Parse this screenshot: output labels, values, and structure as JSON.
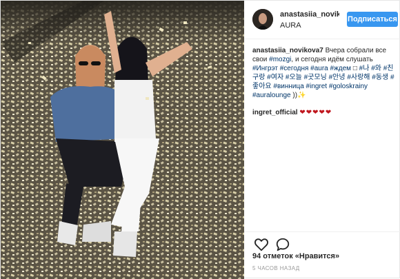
{
  "photo": {
    "description_icon": "photo-of-two-women-in-confetti"
  },
  "header": {
    "username": "anastasiia_novikova7",
    "username_display": "anastasiia_novikov",
    "location": "AURA",
    "follow_label": "Подписаться"
  },
  "comments": {
    "caption_user": "anastasiia_novikova7",
    "caption_text_1": "Вчера собрали все свои ",
    "mention_mozgi": "#mozgi",
    "caption_text_2": ", и сегодня идём слушать ",
    "hashtags_1": "#Ингрэт #сегодня #aura #ждем ",
    "emoji_box": "□",
    "hashtags_2": " #나 #와 #친구랑 #여자 #오늘 #굿모닝 #안녕 #사랑해 #동생 #좋아요 #винница #ingret #goloskrainy #auralounge",
    "caption_tail": " ))",
    "sparkle": "✨",
    "reply_user": "ingret_official",
    "reply_hearts": "❤❤❤❤❤"
  },
  "actions": {
    "like_icon": "heart-icon",
    "comment_icon": "comment-icon",
    "likes_text": "94 отметок «Нравится»",
    "time_text": "5 ЧАСОВ НАЗАД"
  },
  "colors": {
    "follow_button": "#3897f0",
    "hashtag": "#003569",
    "hearts": "#c0181f",
    "muted": "#999999"
  }
}
